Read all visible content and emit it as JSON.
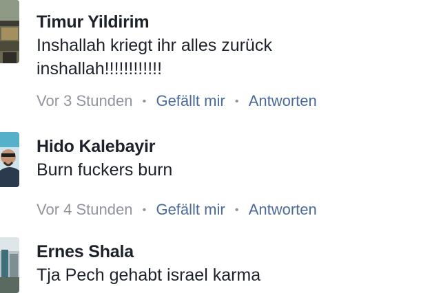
{
  "comments": [
    {
      "author": "Timur Yildirim",
      "text_line1": "Inshallah kriegt ihr alles zurück",
      "text_line2": "inshallah!!!!!!!!!!!!",
      "time": "Vor 3 Stunden",
      "like_label": "Gefällt mir",
      "reply_label": "Antworten"
    },
    {
      "author": "Hido Kalebayir",
      "text_line1": "Burn fuckers burn",
      "time": "Vor 4 Stunden",
      "like_label": "Gefällt mir",
      "reply_label": "Antworten"
    },
    {
      "author": "Ernes Shala",
      "text_line1": "Tja Pech gehabt israel karma"
    }
  ],
  "separator": "•"
}
